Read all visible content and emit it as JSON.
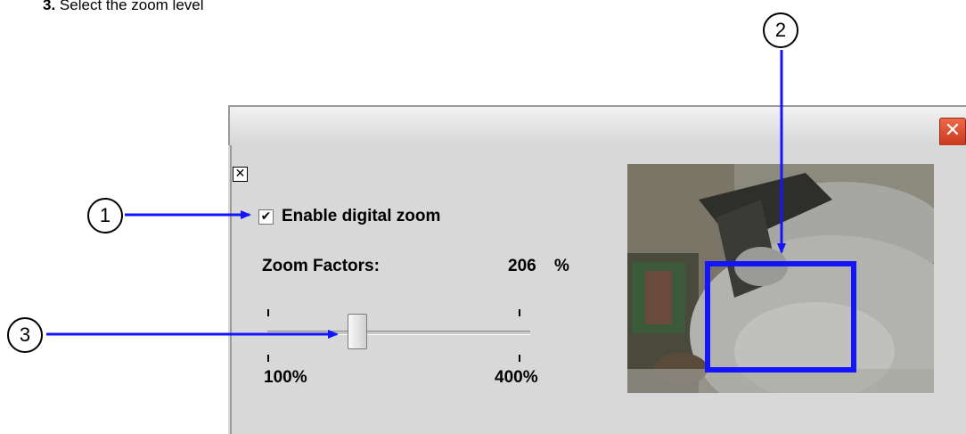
{
  "step": {
    "number": "3.",
    "text": "Select the zoom level"
  },
  "window": {
    "close_glyph": "✕"
  },
  "panel": {
    "close_glyph": "✕",
    "checkbox": {
      "checked": true,
      "glyph": "✔",
      "label": "Enable digital zoom"
    },
    "zoom_factors_label": "Zoom Factors:",
    "zoom_value": "206",
    "zoom_unit": "%",
    "slider": {
      "min_label": "100%",
      "max_label": "400%",
      "min": 100,
      "max": 400,
      "value": 206
    }
  },
  "callouts": [
    "1",
    "2",
    "3"
  ],
  "colors": {
    "accent_blue": "#1414ff",
    "title_close": "#d8482a",
    "window_bg": "#d8d8d8"
  },
  "icons": {
    "window_close": "close-icon",
    "panel_close": "close-box-icon",
    "checkbox": "check-icon"
  }
}
